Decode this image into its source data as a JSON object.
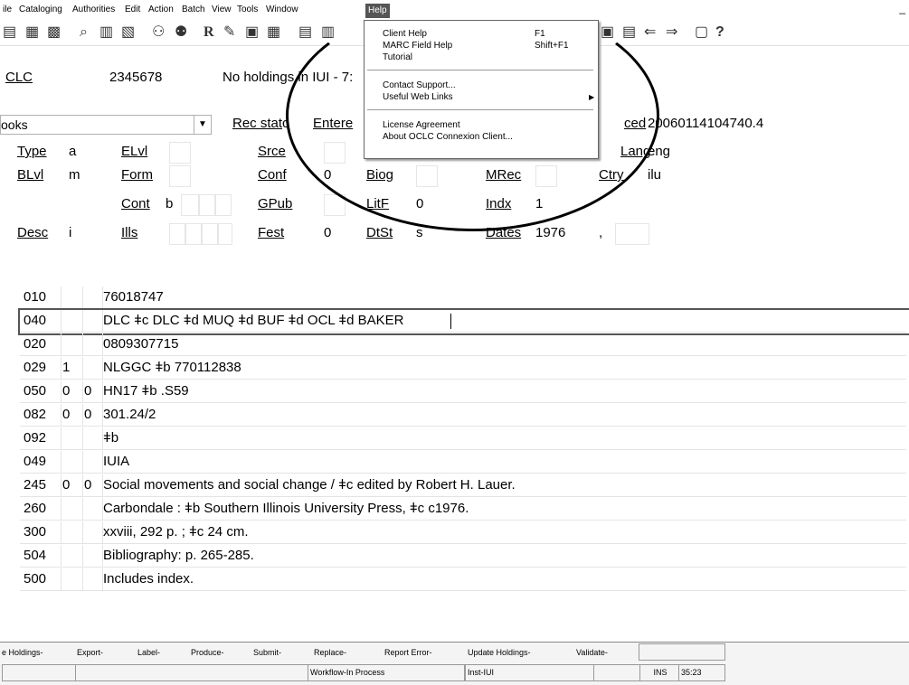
{
  "menubar": {
    "items": [
      "ile",
      "Cataloging",
      "Authorities",
      "Edit",
      "Action",
      "Batch",
      "View",
      "Tools",
      "Window",
      "Help"
    ],
    "minimize": "_"
  },
  "help_menu": {
    "items": [
      {
        "label": "Client Help",
        "shortcut": "F1"
      },
      {
        "label": "MARC Field Help",
        "shortcut": "Shift+F1"
      },
      {
        "label": "Tutorial",
        "shortcut": ""
      },
      {
        "label": "Contact Support...",
        "shortcut": ""
      },
      {
        "label": "Useful Web Links",
        "shortcut": ""
      },
      {
        "label": "License Agreement",
        "shortcut": ""
      },
      {
        "label": "About OCLC Connexion Client...",
        "shortcut": ""
      }
    ]
  },
  "header": {
    "source": "CLC",
    "oclc_number": "2345678",
    "holdings_text": "No holdings in IUI - 7:"
  },
  "fixed_field": {
    "format": "ooks",
    "rec_stat_label": "Rec stat",
    "rec_stat_value": "c",
    "entered_label": "Entere",
    "replaced_label": "ced",
    "replaced_value": "20060114104740.4",
    "rows": [
      [
        {
          "label": "Type",
          "value": "a"
        },
        {
          "label": "ELvl",
          "value": ""
        },
        {
          "label": "Srce",
          "value": ""
        },
        {
          "label": "",
          "value": ""
        },
        {
          "label": "",
          "value": ""
        },
        {
          "label": "Lang",
          "value": "eng"
        }
      ],
      [
        {
          "label": "BLvl",
          "value": "m"
        },
        {
          "label": "Form",
          "value": ""
        },
        {
          "label": "Conf",
          "value": "0"
        },
        {
          "label": "Biog",
          "value": ""
        },
        {
          "label": "MRec",
          "value": ""
        },
        {
          "label": "Ctry",
          "value": "ilu"
        }
      ],
      [
        {
          "label": "",
          "value": ""
        },
        {
          "label": "Cont",
          "value": "b"
        },
        {
          "label": "GPub",
          "value": ""
        },
        {
          "label": "LitF",
          "value": "0"
        },
        {
          "label": "Indx",
          "value": "1"
        },
        {
          "label": "",
          "value": ""
        }
      ],
      [
        {
          "label": "Desc",
          "value": "i"
        },
        {
          "label": "Ills",
          "value": ""
        },
        {
          "label": "Fest",
          "value": "0"
        },
        {
          "label": "DtSt",
          "value": "s"
        },
        {
          "label": "Dates",
          "value": "1976"
        },
        {
          "label": "",
          "value": ","
        }
      ]
    ]
  },
  "variable_fields": [
    {
      "tag": "010",
      "ind1": "",
      "ind2": "",
      "data": " 76018747"
    },
    {
      "tag": "040",
      "ind1": "",
      "ind2": "",
      "data": "DLC ǂc DLC ǂd MUQ ǂd BUF ǂd OCL ǂd BAKER"
    },
    {
      "tag": "020",
      "ind1": "",
      "ind2": "",
      "data": "0809307715"
    },
    {
      "tag": "029",
      "ind1": "1",
      "ind2": "",
      "data": "NLGGC ǂb 770112838"
    },
    {
      "tag": "050",
      "ind1": "0",
      "ind2": "0",
      "data": "HN17 ǂb .S59"
    },
    {
      "tag": "082",
      "ind1": "0",
      "ind2": "0",
      "data": "301.24/2"
    },
    {
      "tag": "092",
      "ind1": "",
      "ind2": "",
      "data": "ǂb"
    },
    {
      "tag": "049",
      "ind1": "",
      "ind2": "",
      "data": "IUIA"
    },
    {
      "tag": "245",
      "ind1": "0",
      "ind2": "0",
      "data": "Social movements and social change / ǂc edited by Robert H. Lauer."
    },
    {
      "tag": "260",
      "ind1": "",
      "ind2": "",
      "data": "Carbondale : ǂb Southern Illinois University Press, ǂc c1976."
    },
    {
      "tag": "300",
      "ind1": "",
      "ind2": "",
      "data": "xxviii, 292 p. ; ǂc 24 cm."
    },
    {
      "tag": "504",
      "ind1": "",
      "ind2": "",
      "data": "Bibliography: p. 265-285."
    },
    {
      "tag": "500",
      "ind1": "",
      "ind2": "",
      "data": "Includes index."
    }
  ],
  "status_buttons": [
    "e Holdings-",
    "Export-",
    "Label-",
    "Produce-",
    "Submit-",
    "Replace-",
    "Report Error-",
    "Update Holdings-",
    "Validate-"
  ],
  "status_info": {
    "workflow": "Workflow-In Process",
    "institution": "Inst-IUI",
    "mode": "INS",
    "position": "35:23"
  },
  "toolbar": {
    "icons": [
      "record-icon",
      "save-online-icon",
      "save-local-icon",
      "search-icon",
      "browse-icon",
      "open-icon",
      "binoculars-icon",
      "binoculars-next-icon",
      "reformat-icon",
      "validate-icon",
      "edit-icon",
      "grid-icon",
      "copy-icon",
      "paste-icon",
      "list-icon",
      "bookmark-icon",
      "arrow-left-icon",
      "arrow-right-icon",
      "help-context-icon",
      "help-icon"
    ],
    "help_glyph": "?",
    "r_glyph": "R"
  },
  "colors": {
    "menu_highlight": "#555555",
    "status_bg": "#f4f4f4"
  }
}
